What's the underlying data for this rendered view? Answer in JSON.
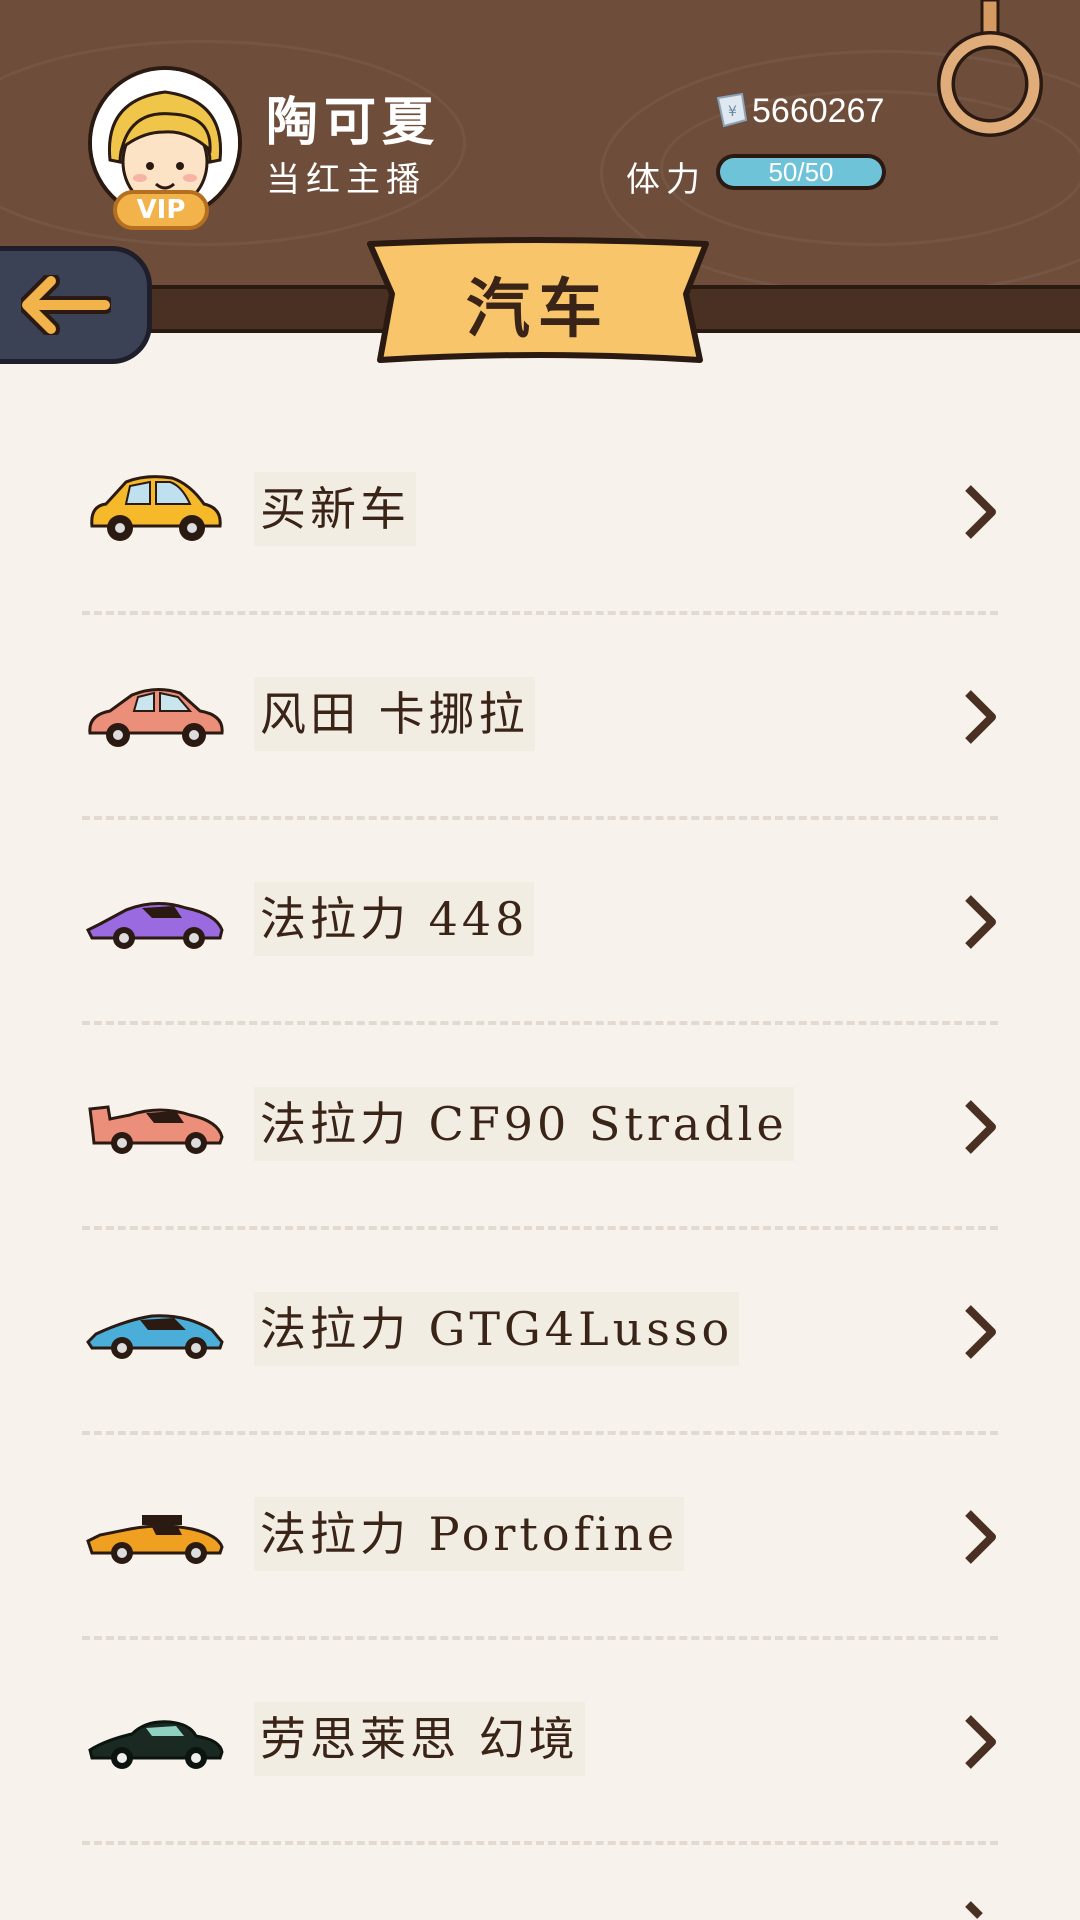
{
  "header": {
    "user_name": "陶可夏",
    "user_title": "当红主播",
    "vip_label": "VIP",
    "coins": "5660267",
    "stamina_label": "体力",
    "stamina_value": "50/50",
    "stamina_fraction": 1.0
  },
  "page_title": "汽车",
  "colors": {
    "header_wood": "#6e4d3b",
    "banner": "#f9c56a",
    "back_button": "#3c4255",
    "back_arrow": "#f2b34a",
    "stamina_fill": "#6ec3d8",
    "background": "#f7f3ec"
  },
  "items": [
    {
      "label": "买新车",
      "car_color": "#f5b92a",
      "icon": "yellow-hatchback-icon"
    },
    {
      "label": "风田  卡挪拉",
      "car_color": "#ec8f7a",
      "icon": "salmon-sedan-icon"
    },
    {
      "label": "法拉力  448",
      "car_color": "#9a6ae0",
      "icon": "purple-supercar-icon"
    },
    {
      "label": "法拉力  CF90 Stradle",
      "car_color": "#ec8f7a",
      "icon": "salmon-supercar-icon"
    },
    {
      "label": "法拉力  GTG4Lusso",
      "car_color": "#4aaed8",
      "icon": "blue-coupe-icon"
    },
    {
      "label": "法拉力  Portofine",
      "car_color": "#f0a020",
      "icon": "orange-roadster-icon"
    },
    {
      "label": "劳思莱思  幻境",
      "car_color": "#1a2a22",
      "icon": "dark-classic-car-icon"
    }
  ]
}
